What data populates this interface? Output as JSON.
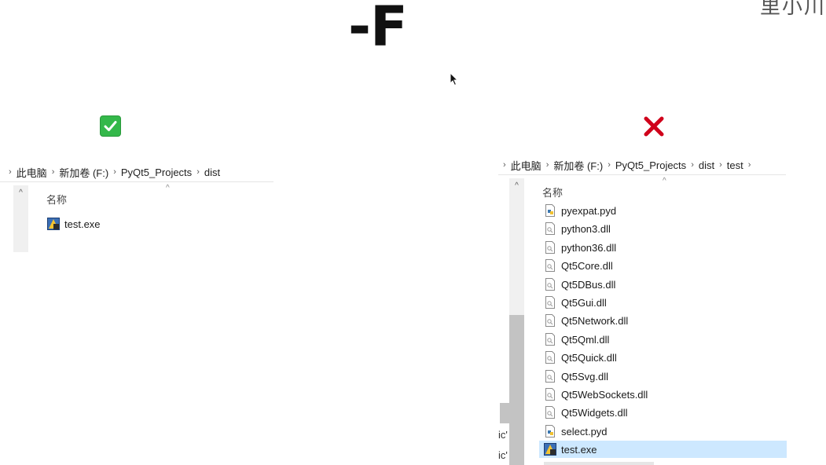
{
  "title": "-F",
  "corner_fragment": "里小川",
  "left_panel": {
    "breadcrumb": [
      "此电脑",
      "新加卷 (F:)",
      "PyQt5_Projects",
      "dist"
    ],
    "column_header": "名称",
    "files": [
      {
        "name": "test.exe",
        "icon": "exe-icon"
      }
    ]
  },
  "right_panel": {
    "breadcrumb": [
      "此电脑",
      "新加卷 (F:)",
      "PyQt5_Projects",
      "dist",
      "test"
    ],
    "column_header": "名称",
    "files": [
      {
        "name": "pyexpat.pyd",
        "icon": "python-file-icon"
      },
      {
        "name": "python3.dll",
        "icon": "dll-file-icon"
      },
      {
        "name": "python36.dll",
        "icon": "dll-file-icon"
      },
      {
        "name": "Qt5Core.dll",
        "icon": "dll-file-icon"
      },
      {
        "name": "Qt5DBus.dll",
        "icon": "dll-file-icon"
      },
      {
        "name": "Qt5Gui.dll",
        "icon": "dll-file-icon"
      },
      {
        "name": "Qt5Network.dll",
        "icon": "dll-file-icon"
      },
      {
        "name": "Qt5Qml.dll",
        "icon": "dll-file-icon"
      },
      {
        "name": "Qt5Quick.dll",
        "icon": "dll-file-icon"
      },
      {
        "name": "Qt5Svg.dll",
        "icon": "dll-file-icon"
      },
      {
        "name": "Qt5WebSockets.dll",
        "icon": "dll-file-icon"
      },
      {
        "name": "Qt5Widgets.dll",
        "icon": "dll-file-icon"
      },
      {
        "name": "select.pyd",
        "icon": "python-file-icon"
      },
      {
        "name": "test.exe",
        "icon": "exe-icon",
        "selected": true
      }
    ],
    "left_edge_fragments": [
      "ic'",
      "ic'"
    ]
  },
  "marks": {
    "left": "check-mark",
    "right": "cross-mark"
  },
  "colors": {
    "selection": "#cde8ff",
    "check_green": "#34b84a",
    "cross_red": "#d0021b"
  }
}
